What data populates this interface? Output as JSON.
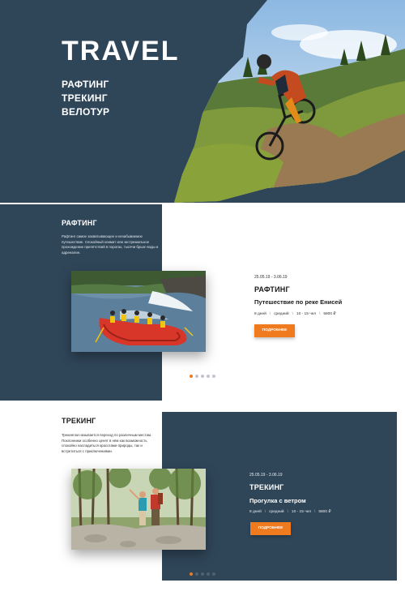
{
  "hero": {
    "title": "TRAVEL",
    "menu": [
      "РАФТИНГ",
      "ТРЕКИНГ",
      "ВЕЛОТУР"
    ]
  },
  "rafting": {
    "heading": "РАФТИНГ",
    "description": "Рафтинг самое захватывающее и незабываемое путешествие. Спокойный климат или экстремальное прохождение препятствий в порогах, тысячи брызг воды и адреналин.",
    "card": {
      "date": "25.05.19 - 3.06.19",
      "title": "РАФТИНГ",
      "subtitle": "Путешествие по реке Енисей",
      "meta": [
        "8 дней",
        "средний",
        "10 - 15 чел",
        "5800 ₽"
      ],
      "button": "ПОДРОБНЕЕ"
    },
    "dots_count": 5,
    "active_dot": 0
  },
  "trekking": {
    "heading": "ТРЕКИНГ",
    "description": "Трекингом называется переход по различным местам. Поклонники особенно ценят в нём как возможность спокойно насладиться красотами природы, так и встретиться с приключениями.",
    "card": {
      "date": "25.05.19 - 3.06.19",
      "title": "ТРЕКИНГ",
      "subtitle": "Прогулка с ветром",
      "meta": [
        "8 дней",
        "средний",
        "10 - 15 чел",
        "5800 ₽"
      ],
      "button": "ПОДРОБНЕЕ"
    },
    "dots_count": 5,
    "active_dot": 0
  },
  "colors": {
    "navy": "#2f4659",
    "accent": "#f07a1e",
    "white": "#ffffff",
    "dot_light": "#bfc5cb",
    "dot_dark": "#506272"
  }
}
